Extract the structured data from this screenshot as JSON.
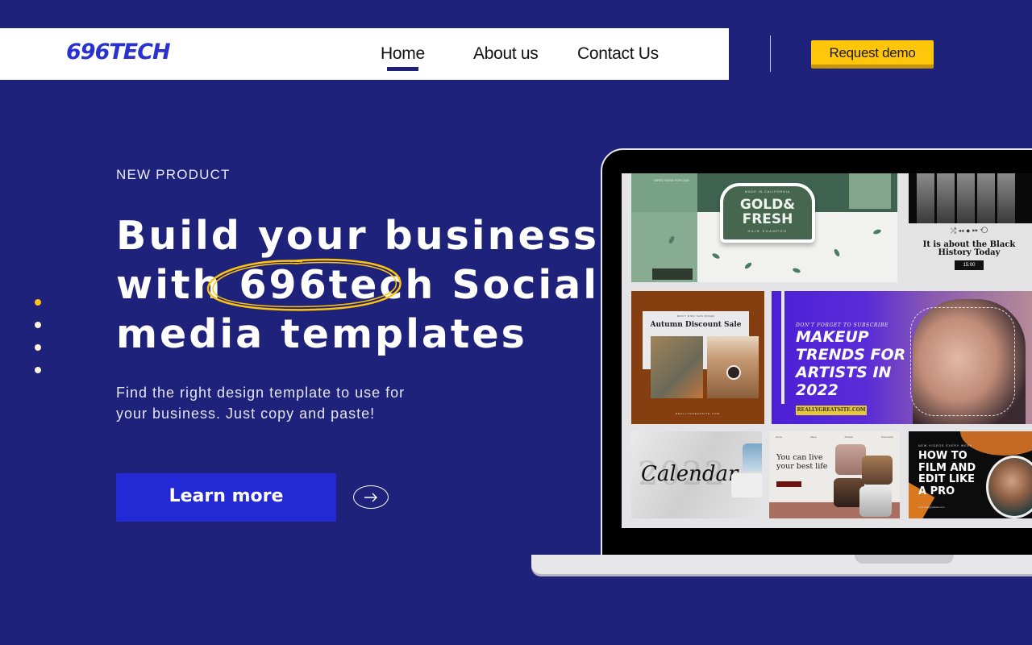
{
  "header": {
    "logo": "696TECH",
    "nav": [
      {
        "label": "Home",
        "active": true
      },
      {
        "label": "About us",
        "active": false
      },
      {
        "label": "Contact Us",
        "active": false
      }
    ],
    "cta_label": "Request demo"
  },
  "hero": {
    "eyebrow": "NEW PRODUCT",
    "headline": {
      "line1": "Build your business",
      "line2_pre": "with ",
      "line2_highlight": "696tech",
      "line2_post": " Social",
      "line3": "media templates"
    },
    "subtitle_line1": "Find the right design template to use for",
    "subtitle_line2": "your business. Just copy and paste!",
    "primary_button": "Learn more",
    "arrow_button_icon": "arrow-right-icon",
    "slider": {
      "total": 4,
      "active_index": 0
    }
  },
  "laptop_screen": {
    "templates": [
      {
        "name": "gold-fresh",
        "title": "GOLD& FRESH",
        "subtitle": "HAIR SHAMPOO",
        "tagline": "MADE IN CALIFORNIA",
        "note": "DIRECTIONS FOR USE:"
      },
      {
        "name": "black-history",
        "title": "It is about the Black History Today",
        "time": "15:00",
        "controls": "⤮ ◂◂ ● ▸▸ ⟲"
      },
      {
        "name": "autumn-sale",
        "kicker": "DON'T MISS THIS OFFER",
        "title": "Autumn Discount Sale",
        "footer": "REALLYGREATSITE.COM"
      },
      {
        "name": "makeup-trends",
        "kicker": "DON'T FORGET TO SUBSCRIBE",
        "title_lines": [
          "MAKEUP",
          "TRENDS FOR",
          "ARTISTS IN",
          "2022"
        ],
        "site": "REALLYGREATSITE.COM"
      },
      {
        "name": "calendar",
        "year": "2022",
        "title": "Calendar"
      },
      {
        "name": "best-life",
        "title_line1": "You can live",
        "title_line2": "your best life",
        "nav": [
          "Home",
          "About",
          "Product",
          "Community"
        ]
      },
      {
        "name": "film-pro",
        "kicker": "NEW VIDEOS EVERY WEEK",
        "title_lines": [
          "HOW TO",
          "FILM AND",
          "EDIT LIKE",
          "A PRO"
        ],
        "url": "www.reallygreatsite.com"
      }
    ]
  },
  "colors": {
    "background": "#1e227b",
    "accent_yellow": "#ffc60b",
    "primary_blue": "#2329d4",
    "logo_blue": "#2a31d1"
  }
}
